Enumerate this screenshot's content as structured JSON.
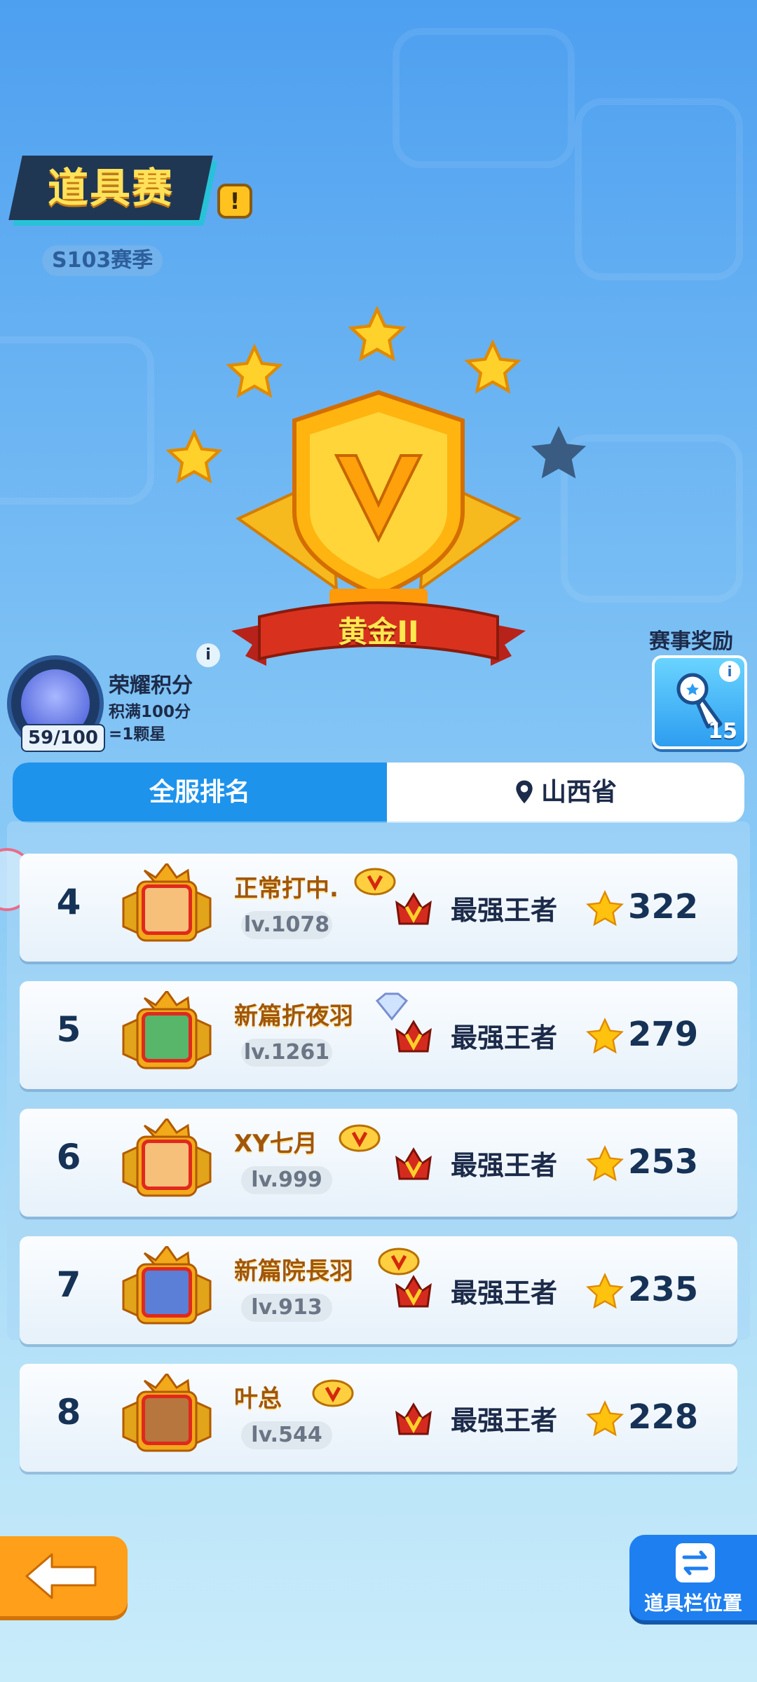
{
  "header": {
    "mode_title": "道具赛",
    "info_mark": "!",
    "season": "S103赛季"
  },
  "rank": {
    "tier_name": "黄金II",
    "stars_filled": 4,
    "stars_total": 5
  },
  "honor": {
    "progress": "59/100",
    "title": "荣耀积分",
    "desc_line1": "积满100分",
    "desc_line2": "=1颗星",
    "info_mark": "i"
  },
  "reward": {
    "label": "赛事奖励",
    "count": "15",
    "info_mark": "i"
  },
  "tabs": {
    "global": "全服排名",
    "local": "山西省"
  },
  "leaderboard": [
    {
      "rank": "4",
      "name": "正常打中.",
      "level": "lv.1078",
      "tier": "最强王者",
      "score": "322"
    },
    {
      "rank": "5",
      "name": "新篇折夜羽",
      "level": "lv.1261",
      "tier": "最强王者",
      "score": "279"
    },
    {
      "rank": "6",
      "name": "XY七月",
      "level": "lv.999",
      "tier": "最强王者",
      "score": "253"
    },
    {
      "rank": "7",
      "name": "新篇院長羽",
      "level": "lv.913",
      "tier": "最强王者",
      "score": "235"
    },
    {
      "rank": "8",
      "name": "叶总",
      "level": "lv.544",
      "tier": "最强王者",
      "score": "228"
    }
  ],
  "footer": {
    "slot_label": "道具栏位置"
  },
  "colors": {
    "gold": "#ffd12a",
    "primary_blue": "#1e93ec",
    "back_orange": "#ff9f1a"
  }
}
